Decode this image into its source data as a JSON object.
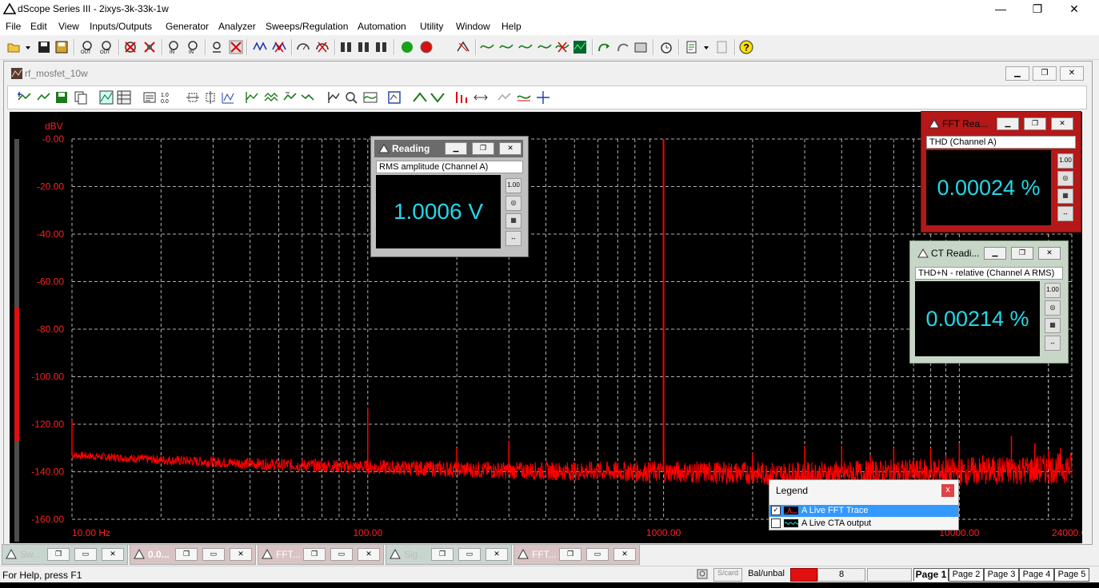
{
  "app": {
    "title": "dScope Series III - 2ixys-3k-33k-1w"
  },
  "window_controls": {
    "minimize": "—",
    "restore": "❐",
    "close": "✕"
  },
  "menu": [
    "File",
    "Edit",
    "View",
    "Inputs/Outputs",
    "Generator",
    "Analyzer",
    "Sweeps/Regulation",
    "Automation",
    "Utility",
    "Window",
    "Help"
  ],
  "child_window": {
    "title": "rf_mosfet_10w"
  },
  "graph": {
    "accent": "#ff2020",
    "grid_color": "#b0b0b0"
  },
  "chart_data": {
    "type": "line",
    "ylabel": "dBV",
    "yticks": [
      "-0.00",
      "-20.00",
      "-40.00",
      "-60.00",
      "-80.00",
      "-100.00",
      "-120.00",
      "-140.00",
      "-160.00"
    ],
    "xticks": [
      "10.00 Hz",
      "100.00",
      "1000.00",
      "10000.00",
      "24000.00"
    ],
    "ylim": [
      -160,
      0
    ],
    "xlim": [
      10,
      24000
    ],
    "xscale": "log",
    "grid": true,
    "series": [
      {
        "name": "A  Live FFT Trace",
        "color": "#ff0000",
        "noise_floor": [
          [
            10,
            -133
          ],
          [
            20,
            -135
          ],
          [
            50,
            -137
          ],
          [
            100,
            -138
          ],
          [
            300,
            -139.5
          ],
          [
            1000,
            -140
          ],
          [
            3000,
            -141
          ],
          [
            10000,
            -140
          ],
          [
            20000,
            -139
          ],
          [
            24000,
            -138
          ]
        ],
        "spikes": [
          [
            10,
            -118
          ],
          [
            100,
            -113
          ],
          [
            200,
            -130
          ],
          [
            300,
            -127
          ],
          [
            1000,
            0
          ],
          [
            2000,
            -132
          ],
          [
            3000,
            -129
          ],
          [
            4000,
            -129
          ],
          [
            5000,
            -133
          ],
          [
            6000,
            -130
          ],
          [
            7000,
            -135
          ],
          [
            8000,
            -130
          ],
          [
            9000,
            -133
          ],
          [
            10000,
            -128
          ],
          [
            11000,
            -134
          ],
          [
            12000,
            -133
          ],
          [
            13000,
            -135
          ],
          [
            15000,
            -125
          ],
          [
            18000,
            -128
          ],
          [
            20000,
            -131
          ],
          [
            22000,
            -130
          ]
        ]
      }
    ]
  },
  "readings": [
    {
      "title": "Reading",
      "caption": "RMS amplitude (Channel A)",
      "value": "1.0006 V"
    },
    {
      "title": "FFT Rea...",
      "caption": "THD (Channel A)",
      "value": "0.00024 %"
    },
    {
      "title": "CT Readi...",
      "caption": "THD+N - relative (Channel A RMS)",
      "value": "0.00214 %"
    }
  ],
  "reading_side_icons": [
    "1.00",
    "◎",
    "▦",
    "↔"
  ],
  "legend": {
    "title": "Legend",
    "close": "x",
    "items": [
      {
        "label": "A  Live FFT Trace",
        "checked": true
      },
      {
        "label": "A  Live CTA output",
        "checked": false
      }
    ]
  },
  "taskbar": [
    {
      "label": "Sw..."
    },
    {
      "label": "0.0..."
    },
    {
      "label": "FFT..."
    },
    {
      "label": "Sig..."
    },
    {
      "label": "FFT..."
    }
  ],
  "status": {
    "help": "For Help, press F1",
    "scard": "S/card",
    "balunbal": "Bal/unbal",
    "value": "8",
    "pages": [
      "Page 1",
      "Page 2",
      "Page 3",
      "Page 4",
      "Page 5"
    ]
  }
}
